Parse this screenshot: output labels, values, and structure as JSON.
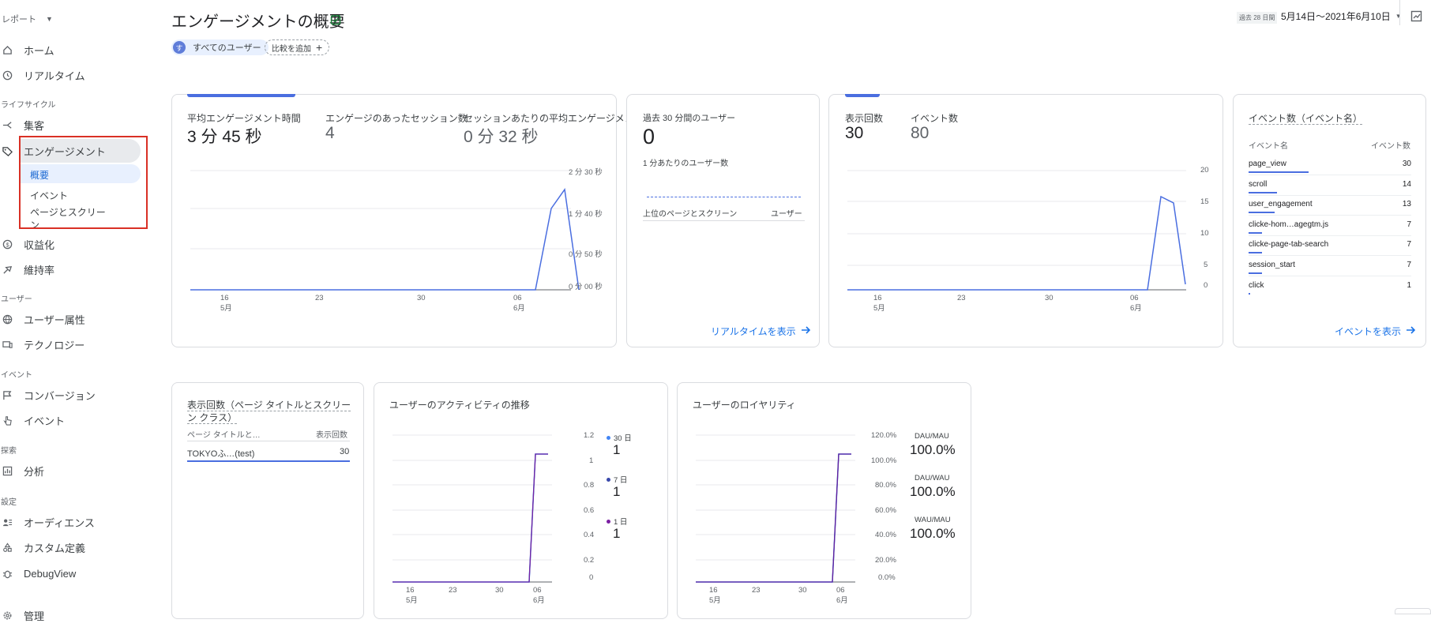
{
  "sidebar": {
    "report_label": "レポート",
    "home": "ホーム",
    "realtime": "リアルタイム",
    "lifecycle": "ライフサイクル",
    "acquisition": "集客",
    "engagement": "エンゲージメント",
    "overview": "概要",
    "events": "イベント",
    "pages_line1": "ページとスクリー",
    "pages_line2": "ン",
    "monetization": "収益化",
    "retention": "維持率",
    "user_section": "ユーザー",
    "user_attributes": "ユーザー属性",
    "technology": "テクノロジー",
    "event_section": "イベント",
    "conversions": "コンバージョン",
    "events2": "イベント",
    "explore_section": "探索",
    "analysis": "分析",
    "config_section": "設定",
    "audiences": "オーディエンス",
    "custom_definitions": "カスタム定義",
    "debugview": "DebugView",
    "admin": "管理"
  },
  "header": {
    "title": "エンゲージメントの概要",
    "segment_letter": "す",
    "segment": "すべてのユーザー",
    "add_compare": "比較を追加",
    "range_prefix": "過去 28 日間",
    "date_range": "5月14日〜2021年6月10日"
  },
  "engagement_card": {
    "m1_label": "平均エンゲージメント時間",
    "m1_value": "3 分 45 秒",
    "m2_label": "エンゲージのあったセッション数",
    "m2_value": "4",
    "m3_label": "セッションあたりの平均エンゲージメント時間",
    "m3_value": "0 分 32 秒",
    "y_ticks": [
      "2 分 30 秒",
      "1 分 40 秒",
      "0 分 50 秒",
      "0 分 00 秒"
    ],
    "x_ticks": [
      "16",
      "23",
      "30",
      "06"
    ],
    "x_month_1": "5月",
    "x_month_2": "6月"
  },
  "realtime_card": {
    "label": "過去 30 分間のユーザー",
    "value": "0",
    "per_minute": "1 分あたりのユーザー数",
    "col1": "上位のページとスクリーン",
    "col2": "ユーザー",
    "link": "リアルタイムを表示"
  },
  "views_card": {
    "m1_label": "表示回数",
    "m1_value": "30",
    "m2_label": "イベント数",
    "m2_value": "80",
    "y_ticks": [
      "20",
      "15",
      "10",
      "5",
      "0"
    ],
    "x_ticks": [
      "16",
      "23",
      "30",
      "06"
    ],
    "x_month_1": "5月",
    "x_month_2": "6月"
  },
  "events_card": {
    "title": "イベント数（イベント名）",
    "col1": "イベント名",
    "col2": "イベント数",
    "rows": [
      {
        "name": "page_view",
        "value": "30",
        "bar": 1.0
      },
      {
        "name": "scroll",
        "value": "14",
        "bar": 0.47
      },
      {
        "name": "user_engagement",
        "value": "13",
        "bar": 0.43
      },
      {
        "name": "clicke-hom…agegtm.js",
        "value": "7",
        "bar": 0.23
      },
      {
        "name": "clicke-page-tab-search",
        "value": "7",
        "bar": 0.23
      },
      {
        "name": "session_start",
        "value": "7",
        "bar": 0.23
      },
      {
        "name": "click",
        "value": "1",
        "bar": 0.03
      }
    ],
    "link": "イベントを表示"
  },
  "pages_card": {
    "title_line1": "表示回数（ページ タイトルとスクリー",
    "title_line2": "ン クラス）",
    "col1": "ページ タイトルと…",
    "col2": "表示回数",
    "row_name": "TOKYOふ…(test)",
    "row_value": "30"
  },
  "activity_card": {
    "title": "ユーザーのアクティビティの推移",
    "y_ticks": [
      "1.2",
      "1",
      "0.8",
      "0.6",
      "0.4",
      "0.2",
      "0"
    ],
    "x_ticks": [
      "16",
      "23",
      "30",
      "06"
    ],
    "x_month_1": "5月",
    "x_month_2": "6月",
    "legend": [
      {
        "label": "30 日",
        "value": "1",
        "color": "#4285f4"
      },
      {
        "label": "7 日",
        "value": "1",
        "color": "#3949ab"
      },
      {
        "label": "1 日",
        "value": "1",
        "color": "#7b1fa2"
      }
    ]
  },
  "loyalty_card": {
    "title": "ユーザーのロイヤリティ",
    "y_ticks": [
      "120.0%",
      "100.0%",
      "80.0%",
      "60.0%",
      "40.0%",
      "20.0%",
      "0.0%"
    ],
    "x_ticks": [
      "16",
      "23",
      "30",
      "06"
    ],
    "x_month_1": "5月",
    "x_month_2": "6月",
    "legend": [
      {
        "label": "DAU/MAU",
        "value": "100.0%"
      },
      {
        "label": "DAU/WAU",
        "value": "100.0%"
      },
      {
        "label": "WAU/MAU",
        "value": "100.0%"
      }
    ]
  },
  "colors": {
    "accent": "#1a73e8",
    "line": "#4a6ee0",
    "highlight_box": "#d93025",
    "purple": "#6a1b9a"
  }
}
